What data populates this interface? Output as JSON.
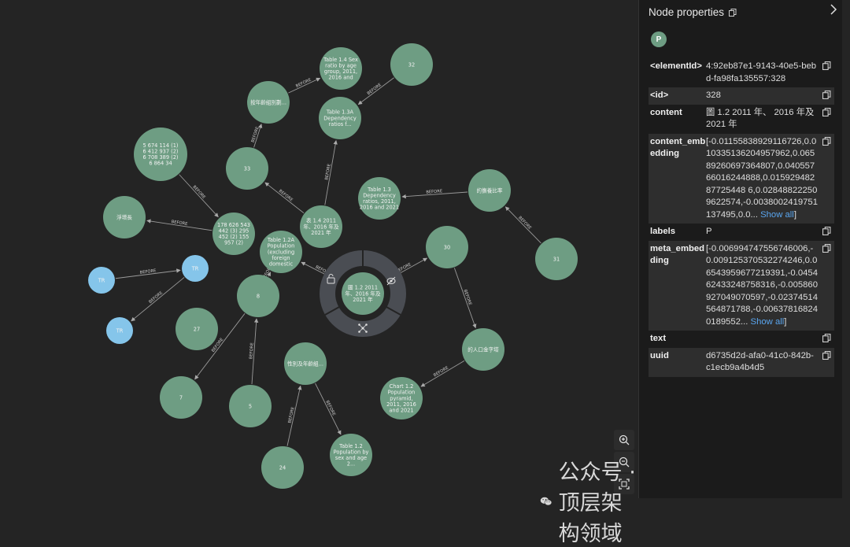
{
  "graph": {
    "nodes": [
      {
        "id": "n_sexratio",
        "label": "Table 1.4 Sex ratio by age group, 2011, 2016 and",
        "type": "green"
      },
      {
        "id": "n_32",
        "label": "32",
        "type": "green"
      },
      {
        "id": "n_agegroup",
        "label": "按年齡組別劃...",
        "type": "green"
      },
      {
        "id": "n_13a",
        "label": "Table 1.3A Dependency ratios f...",
        "type": "green"
      },
      {
        "id": "n_5674",
        "label": "5 674 114 (1) 6 412 937 (2) 6 708 389 (2) 6 864 34",
        "type": "green"
      },
      {
        "id": "n_33",
        "label": "33",
        "type": "green"
      },
      {
        "id": "n_13",
        "label": "Table 1.3 Dependency ratios, 2011, 2016 and 2021",
        "type": "green"
      },
      {
        "id": "n_dependency",
        "label": "的撫養比率",
        "type": "green"
      },
      {
        "id": "n_netgrowth",
        "label": "淨增長",
        "type": "green"
      },
      {
        "id": "n_178",
        "label": "178 626 543 442 (3) 295 452 (2) 155 957 (2)",
        "type": "green"
      },
      {
        "id": "n_14",
        "label": "表 1.4 2011 年、2016 年及 2021 年",
        "type": "green"
      },
      {
        "id": "n_12a",
        "label": "Table 1.2A Population (excluding foreign domestic",
        "type": "green"
      },
      {
        "id": "n_30",
        "label": "30",
        "type": "green"
      },
      {
        "id": "n_31",
        "label": "31",
        "type": "green"
      },
      {
        "id": "n_tr1",
        "label": "TR",
        "type": "blue"
      },
      {
        "id": "n_tr2",
        "label": "TR",
        "type": "blue"
      },
      {
        "id": "n_tr3",
        "label": "TR",
        "type": "blue"
      },
      {
        "id": "n_center",
        "label": "圖 1.2 2011 年、2016 年及 2021 年",
        "type": "selected"
      },
      {
        "id": "n_8",
        "label": "8",
        "type": "green"
      },
      {
        "id": "n_27",
        "label": "27",
        "type": "green"
      },
      {
        "id": "n_pyramid_zh",
        "label": "的人口金字塔",
        "type": "green"
      },
      {
        "id": "n_sexage",
        "label": "性別及年齡組...",
        "type": "green"
      },
      {
        "id": "n_7",
        "label": "7",
        "type": "green"
      },
      {
        "id": "n_5",
        "label": "5",
        "type": "green"
      },
      {
        "id": "n_chart12",
        "label": "Chart 1.2 Population pyramid, 2011, 2016 and 2021",
        "type": "green"
      },
      {
        "id": "n_24",
        "label": "24",
        "type": "green"
      },
      {
        "id": "n_12",
        "label": "Table 1.2 Population by sex and age 2...",
        "type": "green"
      }
    ],
    "edges": [
      {
        "from": "n_agegroup",
        "to": "n_sexratio",
        "label": "BEFORE"
      },
      {
        "from": "n_32",
        "to": "n_13a",
        "label": "BEFORE"
      },
      {
        "from": "n_33",
        "to": "n_agegroup",
        "label": "BEFORE"
      },
      {
        "from": "n_14",
        "to": "n_13a",
        "label": "BEFORE"
      },
      {
        "from": "n_14",
        "to": "n_33",
        "label": "BEFORE"
      },
      {
        "from": "n_5674",
        "to": "n_178",
        "label": "BEFORE"
      },
      {
        "from": "n_178",
        "to": "n_netgrowth",
        "label": "BEFORE"
      },
      {
        "from": "n_dependency",
        "to": "n_13",
        "label": "BEFORE"
      },
      {
        "from": "n_31",
        "to": "n_dependency",
        "label": "BEFORE"
      },
      {
        "from": "n_center",
        "to": "n_12a",
        "label": "BEFORE"
      },
      {
        "from": "n_center",
        "to": "n_30",
        "label": "BEFORE"
      },
      {
        "from": "n_30",
        "to": "n_pyramid_zh",
        "label": "BEFORE"
      },
      {
        "from": "n_pyramid_zh",
        "to": "n_chart12",
        "label": "BEFORE"
      },
      {
        "from": "n_tr1",
        "to": "n_tr2",
        "label": "BEFORE"
      },
      {
        "from": "n_tr2",
        "to": "n_tr3",
        "label": "BEFORE"
      },
      {
        "from": "n_8",
        "to": "n_12a",
        "label": "BEFORE"
      },
      {
        "from": "n_8",
        "to": "n_7",
        "label": "BEFORE"
      },
      {
        "from": "n_5",
        "to": "n_8",
        "label": "BEFORE"
      },
      {
        "from": "n_24",
        "to": "n_sexage",
        "label": "BEFORE"
      },
      {
        "from": "n_sexage",
        "to": "n_12",
        "label": "BEFORE"
      }
    ],
    "ring_icons": [
      "lock-open-icon",
      "eye-off-icon",
      "expand-graph-icon"
    ]
  },
  "zoom": {
    "in_icon": "zoom-in-icon",
    "out_icon": "zoom-out-icon",
    "fit_icon": "fit-screen-icon"
  },
  "panel": {
    "title": "Node properties",
    "badge": "P",
    "show_all": "Show all",
    "properties": [
      {
        "key": "<elementId>",
        "value": "4:92eb87e1-9143-40e5-bebd-fa98fa135557:328",
        "alt": false
      },
      {
        "key": "<id>",
        "value": "328",
        "alt": true
      },
      {
        "key": "content",
        "value": "圖 1.2  2011 年、 2016 年及 2021 年",
        "alt": false
      },
      {
        "key": "content_embedding",
        "value": "[-0.01155838929116726,0.010335136204957962,0.06589260697364807,0.04055766016244888,0.01592948287725448 6,0.028488222509622574,-0.0038002419751137495,0.0...",
        "alt": true,
        "more": true
      },
      {
        "key": "labels",
        "value": "P",
        "alt": false
      },
      {
        "key": "meta_embedding",
        "value": "[-0.006994747556746006,-0.009125370532274246,0.06543959677219391,-0.045462433248758316,-0.005860927049070597,-0.02374514564871788,-0.006378168240189552...",
        "alt": true,
        "more": true
      },
      {
        "key": "text",
        "value": "",
        "alt": false
      },
      {
        "key": "uuid",
        "value": "d6735d2d-afa0-41c0-842b-c1ecb9a4b4d5",
        "alt": true
      }
    ]
  },
  "watermark": {
    "text": "公众号 · 顶层架构领域",
    "icon": "wechat-icon"
  },
  "colors": {
    "node_green": "#6e9d83",
    "node_blue": "#85c5ea",
    "selected_ring": "#4a4d53",
    "link": "#5aa6ef"
  }
}
